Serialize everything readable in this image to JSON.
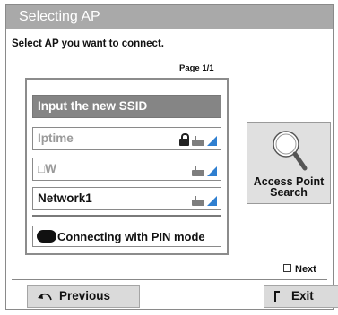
{
  "window": {
    "title": "Selecting AP"
  },
  "instruction": "Select AP you want to connect.",
  "page": "Page 1/1",
  "list": {
    "input_row": "Input the new SSID",
    "access_points": [
      {
        "ssid": "Iptime",
        "secured": true,
        "muted": true
      },
      {
        "ssid": "□W",
        "secured": false,
        "muted": true
      },
      {
        "ssid": "Network1",
        "secured": false,
        "muted": false
      }
    ],
    "pin_mode": "Connecting with PIN mode"
  },
  "search": {
    "line1": "Access Point",
    "line2": "Search"
  },
  "hint": {
    "next": "Next"
  },
  "buttons": {
    "previous": "Previous",
    "exit": "Exit"
  },
  "icons": {
    "lock": "lock-icon",
    "router": "router-icon",
    "signal": "signal-icon",
    "search": "magnifier-icon"
  },
  "colors": {
    "title_bar": "#a9a9a9",
    "signal": "#2f7fd0",
    "selected_row": "#858585"
  }
}
